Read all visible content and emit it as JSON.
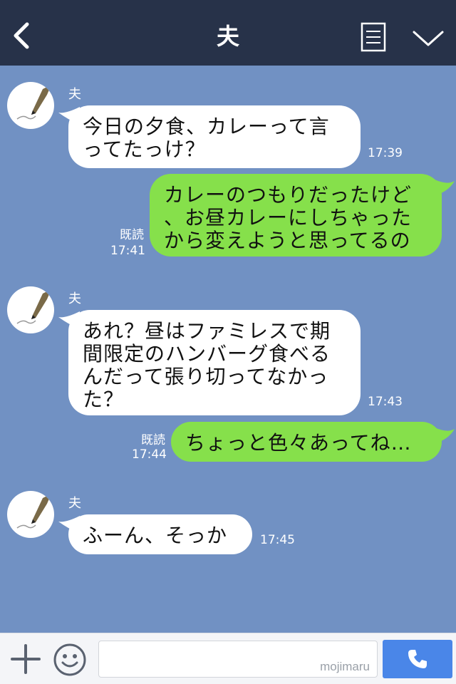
{
  "header": {
    "title": "夫",
    "back_icon": "chevron-left-icon",
    "note_icon": "notes-icon",
    "menu_icon": "chevron-down-icon",
    "background": "#273249"
  },
  "chat": {
    "background": "#7191c3",
    "messages": [
      {
        "side": "received",
        "sender": "夫",
        "text": "今日の夕食、カレーって言\nってたっけ？",
        "time": "17:39"
      },
      {
        "side": "sent",
        "read": "既読",
        "text": "カレーのつもりだったけど\n、お昼カレーにしちゃった\nから変えようと思ってるの",
        "time": "17:41"
      },
      {
        "side": "received",
        "sender": "夫",
        "text": "あれ？昼はファミレスで期\n間限定のハンバーグ食べる\nんだって張り切ってなかっ\nた？",
        "time": "17:43"
      },
      {
        "side": "sent",
        "read": "既読",
        "text": "ちょっと色々あってね…",
        "time": "17:44"
      },
      {
        "side": "received",
        "sender": "夫",
        "text": "ふーん、そっか",
        "time": "17:45"
      }
    ]
  },
  "footer": {
    "plus_icon": "plus-icon",
    "emoji_icon": "emoji-icon",
    "input_value": "",
    "watermark": "mojimaru",
    "call_icon": "phone-icon",
    "call_color": "#4a86e8"
  },
  "colors": {
    "sent_bubble": "#86e04b",
    "received_bubble": "#ffffff"
  }
}
